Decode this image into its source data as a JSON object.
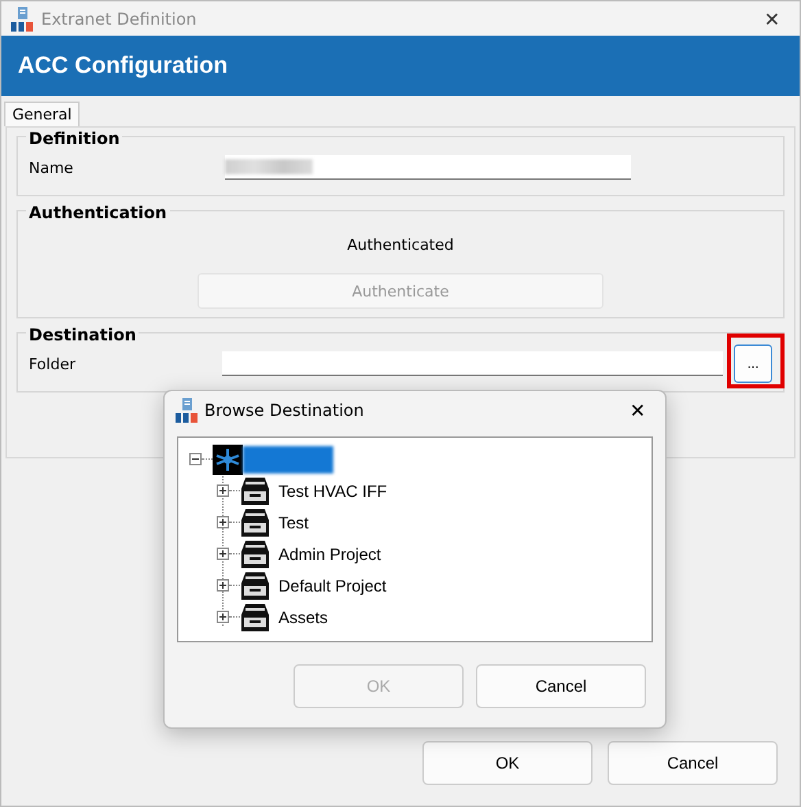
{
  "window": {
    "title": "Extranet Definition",
    "close": "✕"
  },
  "header": {
    "title": "ACC Configuration"
  },
  "tabs": [
    {
      "label": "General",
      "selected": true
    }
  ],
  "sections": [
    {
      "kind": "field",
      "title": "Definition",
      "label": "Name"
    },
    {
      "kind": "auth",
      "title": "Authentication",
      "status": "Authenticated",
      "button": {
        "label": "Authenticate",
        "disabled": true
      }
    },
    {
      "kind": "browse",
      "title": "Destination",
      "label": "Folder",
      "button": {
        "label": "...",
        "highlighted": true
      }
    }
  ],
  "buttons": [
    {
      "label": "OK",
      "disabled": false
    },
    {
      "label": "Cancel",
      "disabled": false
    }
  ],
  "dialog": {
    "title": "Browse Destination",
    "close": "✕",
    "tree": [
      {
        "kind": "hub",
        "expanded": true,
        "selected": true,
        "children": [
          {
            "label": "Test HVAC IFF",
            "kind": "drawer",
            "expanded": false
          },
          {
            "label": "Test",
            "kind": "drawer",
            "expanded": false
          },
          {
            "label": "Admin Project",
            "kind": "drawer",
            "expanded": false
          },
          {
            "label": "Default Project",
            "kind": "drawer",
            "expanded": false
          },
          {
            "label": "Assets",
            "kind": "drawer",
            "expanded": false
          }
        ]
      }
    ],
    "buttons": [
      {
        "label": "OK",
        "disabled": true
      },
      {
        "label": "Cancel",
        "disabled": false
      }
    ]
  }
}
